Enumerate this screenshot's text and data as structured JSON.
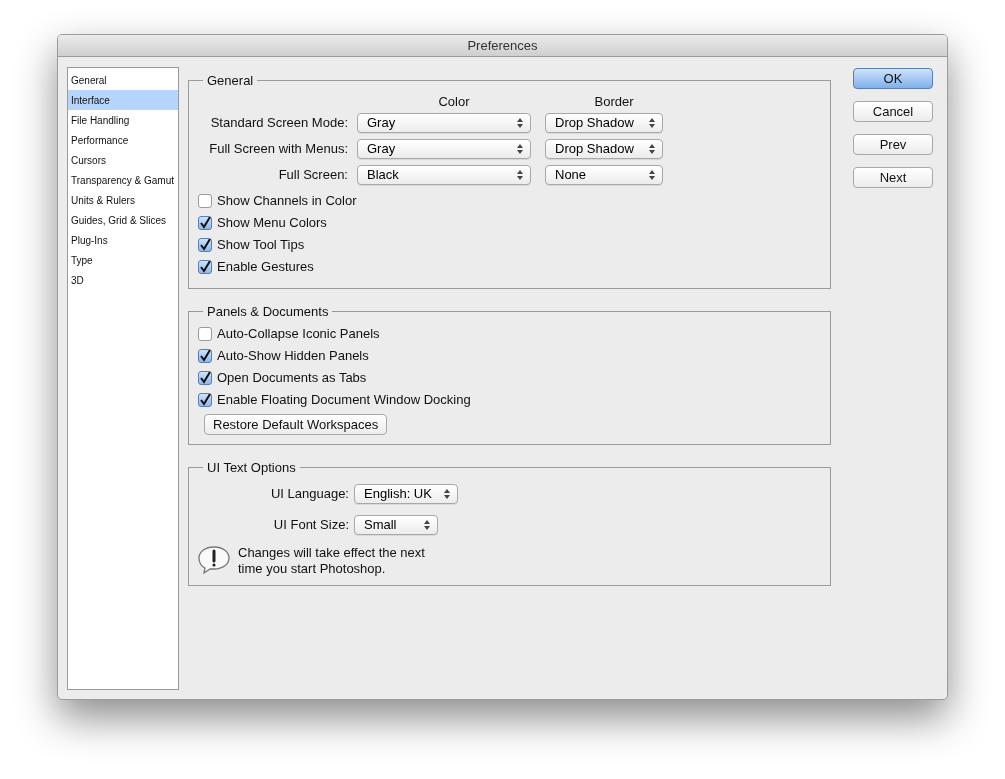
{
  "window": {
    "title": "Preferences"
  },
  "sidebar": {
    "items": [
      {
        "label": "General",
        "selected": false
      },
      {
        "label": "Interface",
        "selected": true
      },
      {
        "label": "File Handling",
        "selected": false
      },
      {
        "label": "Performance",
        "selected": false
      },
      {
        "label": "Cursors",
        "selected": false
      },
      {
        "label": "Transparency & Gamut",
        "selected": false
      },
      {
        "label": "Units & Rulers",
        "selected": false
      },
      {
        "label": "Guides, Grid & Slices",
        "selected": false
      },
      {
        "label": "Plug-Ins",
        "selected": false
      },
      {
        "label": "Type",
        "selected": false
      },
      {
        "label": "3D",
        "selected": false
      }
    ]
  },
  "general": {
    "title": "General",
    "column_headers": [
      "Color",
      "Border"
    ],
    "rows": [
      {
        "label": "Standard Screen Mode:",
        "screen_color": "Gray",
        "border": "Drop Shadow"
      },
      {
        "label": "Full Screen with Menus:",
        "screen_color": "Gray",
        "border": "Drop Shadow"
      },
      {
        "label": "Full Screen:",
        "screen_color": "Black",
        "border": "None"
      }
    ],
    "checkboxes": [
      {
        "label": "Show Channels in Color",
        "checked": false
      },
      {
        "label": "Show Menu Colors",
        "checked": true
      },
      {
        "label": "Show Tool Tips",
        "checked": true
      },
      {
        "label": "Enable Gestures",
        "checked": true
      }
    ]
  },
  "panels_documents": {
    "title": "Panels & Documents",
    "checkboxes": [
      {
        "label": "Auto-Collapse Iconic Panels",
        "checked": false
      },
      {
        "label": "Auto-Show Hidden Panels",
        "checked": true
      },
      {
        "label": "Open Documents as Tabs",
        "checked": true
      },
      {
        "label": "Enable Floating Document Window Docking",
        "checked": true
      }
    ],
    "button": "Restore Default Workspaces"
  },
  "ui_text_options": {
    "title": "UI Text Options",
    "fields": [
      {
        "label": "UI Language:",
        "value": "English: UK"
      },
      {
        "label": "UI Font Size:",
        "value": "Small"
      }
    ],
    "note": "Changes will take effect the next time you start Photoshop."
  },
  "buttons": [
    {
      "label": "OK",
      "default": true
    },
    {
      "label": "Cancel",
      "default": false
    },
    {
      "label": "Prev",
      "default": false
    },
    {
      "label": "Next",
      "default": false
    }
  ]
}
